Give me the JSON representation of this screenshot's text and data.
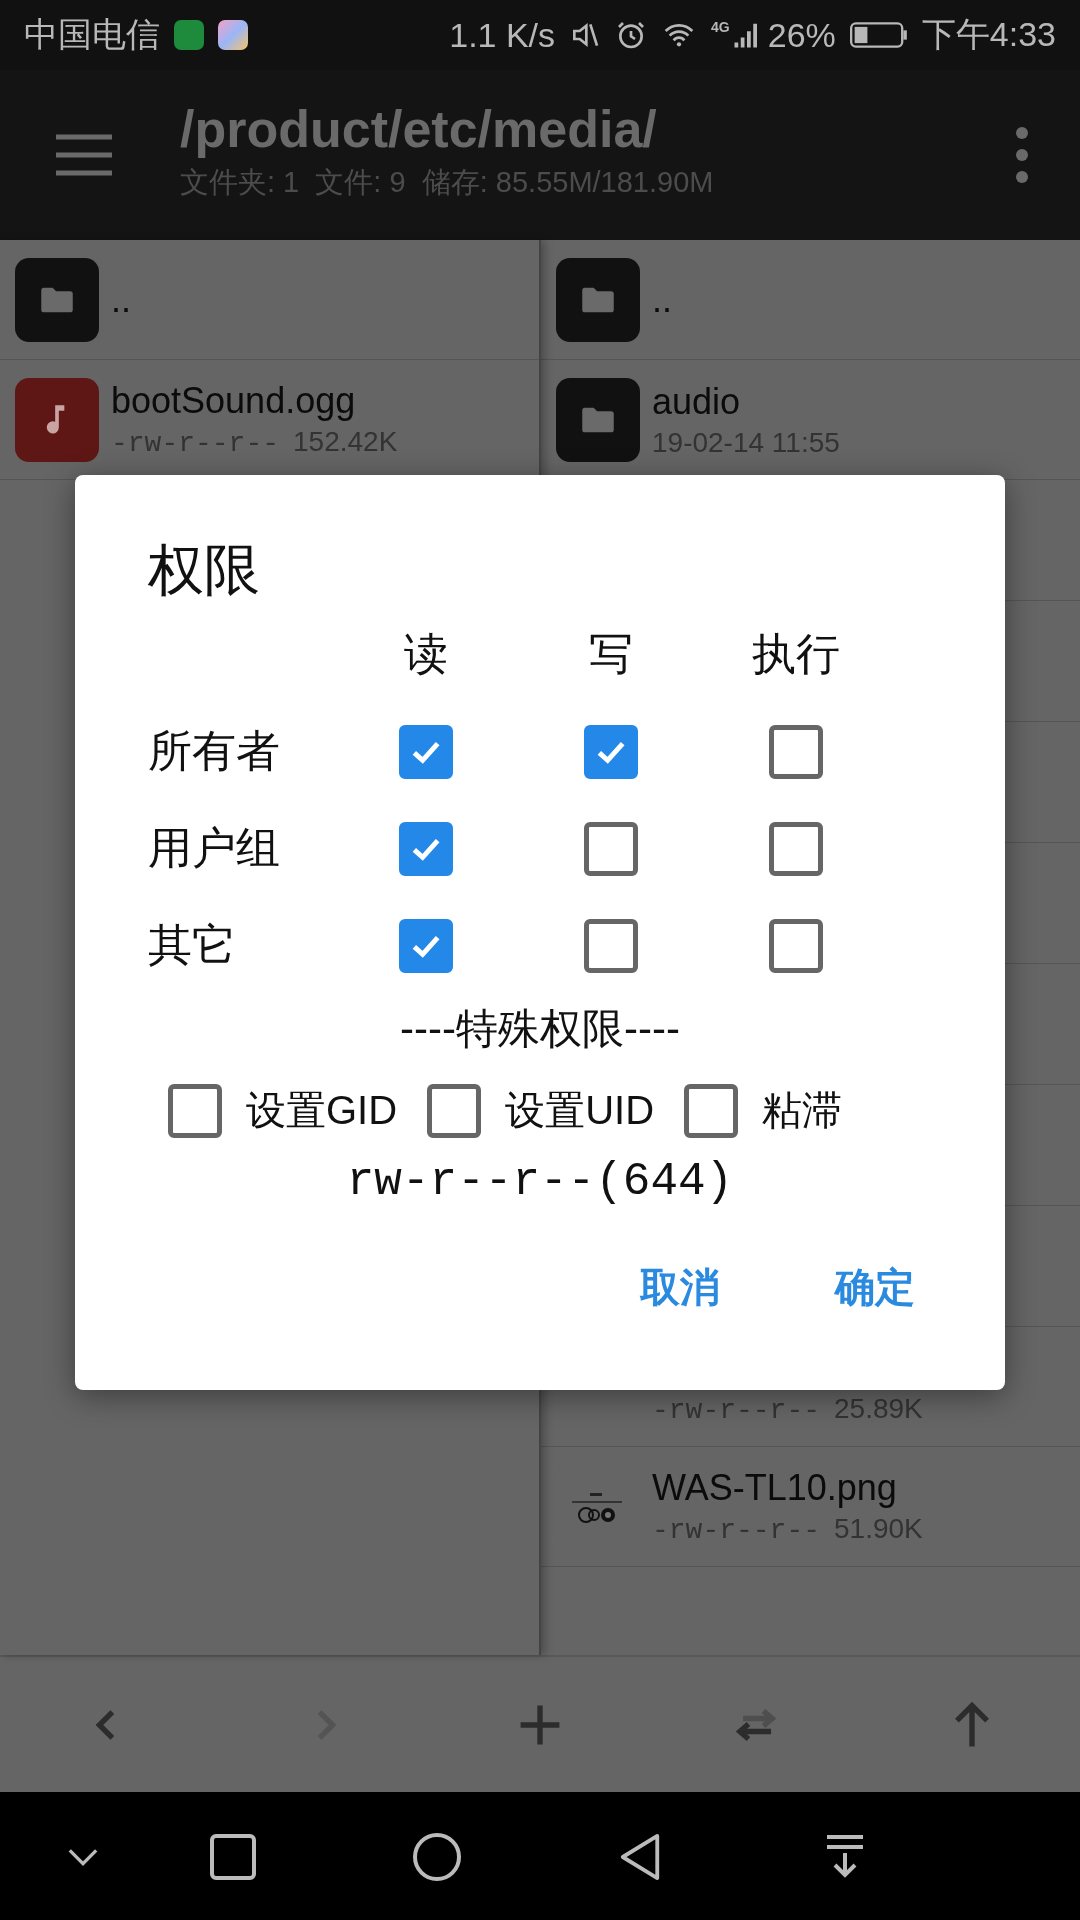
{
  "status_bar": {
    "carrier": "中国电信",
    "speed": "1.1 K/s",
    "network": "4G",
    "battery": "26%",
    "time": "下午4:33"
  },
  "header": {
    "path": "/product/etc/media/",
    "summary": "文件夹: 1  文件: 9  储存: 85.55M/181.90M"
  },
  "left_pane": {
    "items": [
      {
        "kind": "folder",
        "name": ".."
      },
      {
        "kind": "audio",
        "name": "bootSound.ogg",
        "permissions": "-rw-r--r--",
        "size": "152.42K"
      }
    ]
  },
  "right_pane": {
    "top_items": [
      {
        "kind": "folder",
        "name": ".."
      },
      {
        "kind": "folder",
        "name": "audio",
        "date": "19-02-14 11:55"
      }
    ],
    "bottom_items": [
      {
        "kind": "file",
        "permissions": "-rw-r--r--",
        "size": "25.89K"
      },
      {
        "name": "WAS-TL10.png",
        "permissions": "-rw-r--r--",
        "size": "51.90K"
      }
    ]
  },
  "dialog": {
    "title": "权限",
    "columns": [
      "读",
      "写",
      "执行"
    ],
    "rows": [
      {
        "label": "所有者",
        "read": true,
        "write": true,
        "execute": false
      },
      {
        "label": "用户组",
        "read": true,
        "write": false,
        "execute": false
      },
      {
        "label": "其它",
        "read": true,
        "write": false,
        "execute": false
      }
    ],
    "special_title": "----特殊权限----",
    "special": [
      {
        "label": "设置GID",
        "checked": false
      },
      {
        "label": "设置UID",
        "checked": false
      },
      {
        "label": "粘滞",
        "checked": false
      }
    ],
    "mode": "rw-r--r--(644)",
    "buttons": [
      "取消",
      "确定"
    ]
  },
  "toolbar": {
    "buttons": [
      {
        "kind": "back",
        "disabled": false
      },
      {
        "kind": "forward",
        "disabled": true
      },
      {
        "kind": "add",
        "disabled": false
      },
      {
        "kind": "swap",
        "disabled": false
      },
      {
        "kind": "up",
        "disabled": false
      }
    ]
  }
}
